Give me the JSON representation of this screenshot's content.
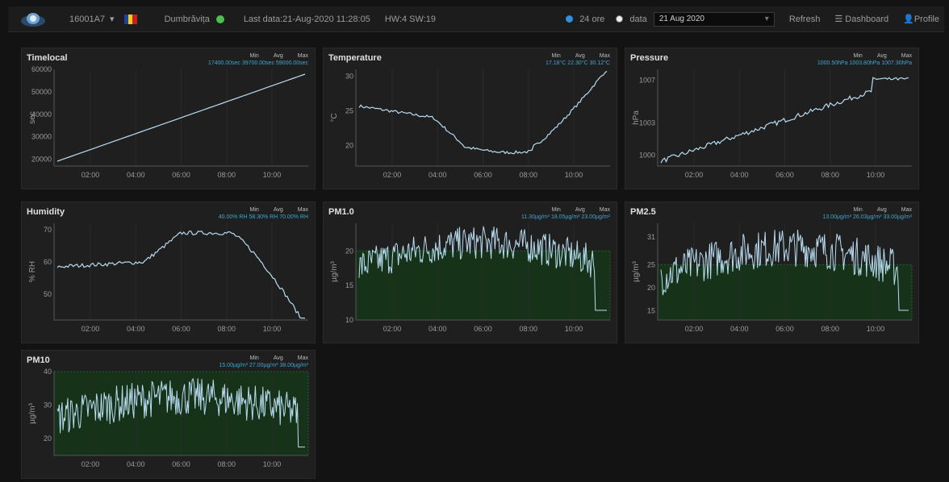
{
  "header": {
    "device_id": "16001A7",
    "city": "Dumbrăvița",
    "last_data": "Last data:21-Aug-2020 11:28:05",
    "hw_sw": "HW:4 SW:19",
    "range_24h_label": "24 ore",
    "range_date_label": "data",
    "date_value": "21 Aug 2020",
    "refresh_label": "Refresh",
    "dashboard_label": "Dashboard",
    "profile_label": "Profile",
    "colors": {
      "status_dot": "#4cc04c",
      "radio_active": "#2f8fe0"
    }
  },
  "stats_header": {
    "min": "Min",
    "avg": "Avg",
    "max": "Max"
  },
  "x_ticks": [
    "02:00",
    "04:00",
    "06:00",
    "08:00",
    "10:00"
  ],
  "panels": [
    {
      "id": "timelocal",
      "title": "Timelocal",
      "ylabel": "sec",
      "stats": "17400.00sec 39700.00sec 59000.00sec",
      "yticks": [
        "60000",
        "50000",
        "40000",
        "30000",
        "20000"
      ],
      "ymin": 17000,
      "ymax": 60000,
      "band": null
    },
    {
      "id": "temperature",
      "title": "Temperature",
      "ylabel": "°C",
      "stats": "17.18°C 22.30°C 30.12°C",
      "yticks": [
        "30",
        "25",
        "20"
      ],
      "ymin": 17,
      "ymax": 31,
      "band": null
    },
    {
      "id": "pressure",
      "title": "Pressure",
      "ylabel": "hPa",
      "stats": "1000.50hPa 1003.80hPa 1007.30hPa",
      "yticks": [
        "1007",
        "1003",
        "1000"
      ],
      "ymin": 999,
      "ymax": 1008,
      "band": null
    },
    {
      "id": "humidity",
      "title": "Humidity",
      "ylabel": "% RH",
      "stats": "40.00% RH 58.30% RH 70.00% RH",
      "yticks": [
        "70",
        "60",
        "50"
      ],
      "ymin": 42,
      "ymax": 72,
      "band": null
    },
    {
      "id": "pm1",
      "title": "PM1.0",
      "ylabel": "µg/m³",
      "stats": "11.30µg/m³ 18.05µg/m³ 23.00µg/m³",
      "yticks": [
        "20",
        "15",
        "10"
      ],
      "ymin": 10,
      "ymax": 24,
      "band": 20
    },
    {
      "id": "pm25",
      "title": "PM2.5",
      "ylabel": "µg/m³",
      "stats": "13.00µg/m³ 26.03µg/m³ 33.00µg/m³",
      "yticks": [
        "31",
        "25",
        "20",
        "15"
      ],
      "ymin": 13,
      "ymax": 34,
      "band": 25
    },
    {
      "id": "pm10",
      "title": "PM10",
      "ylabel": "µg/m³",
      "stats": "15.00µg/m³ 27.00µg/m³ 38.00µg/m³",
      "yticks": [
        "40",
        "30",
        "20"
      ],
      "ymin": 15,
      "ymax": 40,
      "band": 40
    }
  ]
}
